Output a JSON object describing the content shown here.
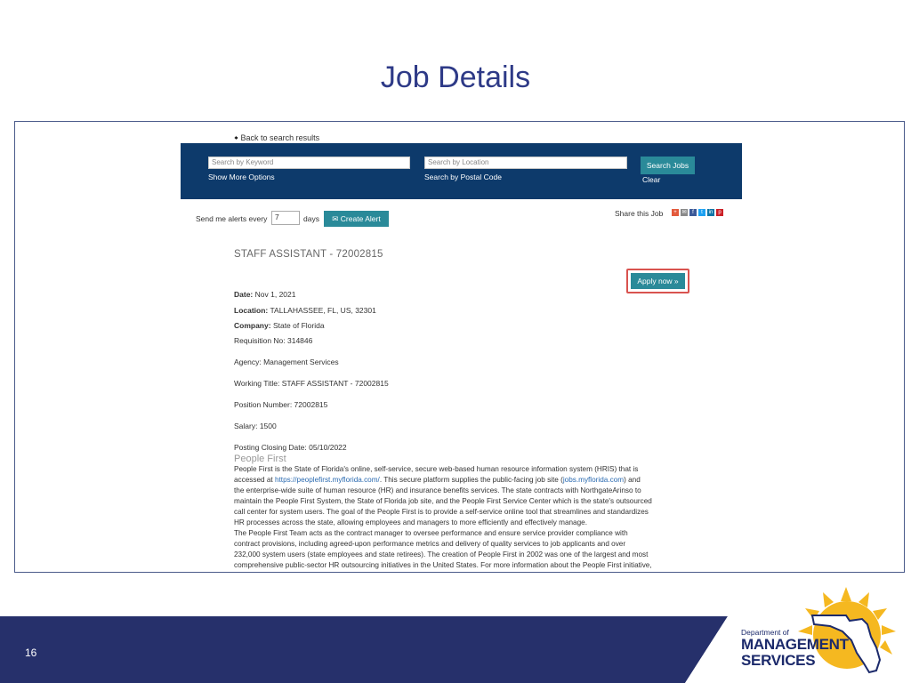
{
  "slide": {
    "title": "Job Details",
    "page_number": "16"
  },
  "page": {
    "back_link": "Back to search results",
    "search": {
      "keyword_placeholder": "Search by Keyword",
      "location_placeholder": "Search by Location",
      "show_more": "Show More Options",
      "postal": "Search by Postal Code",
      "search_button": "Search Jobs",
      "clear": "Clear"
    },
    "alerts": {
      "label": "Send me alerts every",
      "value": "7",
      "unit": "days",
      "button": "Create Alert"
    },
    "share": {
      "label": "Share this Job",
      "icons": [
        "plus-icon",
        "email-icon",
        "facebook-icon",
        "twitter-icon",
        "linkedin-icon",
        "pinterest-icon"
      ]
    },
    "job": {
      "title": "STAFF ASSISTANT - 72002815",
      "apply_button": "Apply now »",
      "date_label": "Date:",
      "date_value": "Nov 1, 2021",
      "location_label": "Location:",
      "location_value": "TALLAHASSEE, FL, US, 32301",
      "company_label": "Company:",
      "company_value": "State of Florida",
      "requisition": "Requisition No: 314846",
      "agency": "Agency: Management Services",
      "working_title": "Working Title: STAFF ASSISTANT - 72002815",
      "position_number": "Position Number: 72002815",
      "salary": "Salary:  1500",
      "closing_date": "Posting Closing Date: 05/10/2022"
    },
    "people_first": {
      "heading": "People First",
      "line1": "People First is the State of Florida's online, self-service, secure web-based human resource information system (HRIS) that is",
      "line2_a": "accessed at ",
      "line2_link": "https://peoplefirst.myflorida.com/",
      "line2_b": ".  This secure platform supplies the public-facing job site (",
      "line2_link2": "jobs.myflorida.com",
      "line2_c": ") and",
      "line3": "the enterprise-wide suite of human resource (HR) and insurance benefits services. The state contracts with NorthgateArinso to",
      "line4": "maintain the People First System, the State of Florida job site, and the People First Service Center which is the state's outsourced",
      "line5": "call center for system users.  The goal of the People First is to provide a self-service online tool that streamlines and standardizes",
      "line6": "HR processes across the state, allowing employees and managers to more efficiently and effectively manage.",
      "line7": "The People First Team acts as the contract manager to oversee performance and ensure service provider compliance with",
      "line8": "contract provisions, including agreed-upon performance metrics and delivery of quality services to job applicants and over",
      "line9": "232,000 system users (state employees and state retirees).  The creation of People First in 2002 was one of the largest and most",
      "line10": "comprehensive public-sector HR outsourcing initiatives in the United States. For more information about the People First initiative,"
    }
  },
  "logo": {
    "dept": "Department of",
    "line1": "MANAGEMENT",
    "line2": "SERVICES"
  },
  "colors": {
    "title": "#2e3a87",
    "footer": "#26306b",
    "search_bar": "#0d3a6b",
    "button": "#2a8a99",
    "highlight": "#d9534f",
    "logo_sun": "#f5b820"
  }
}
